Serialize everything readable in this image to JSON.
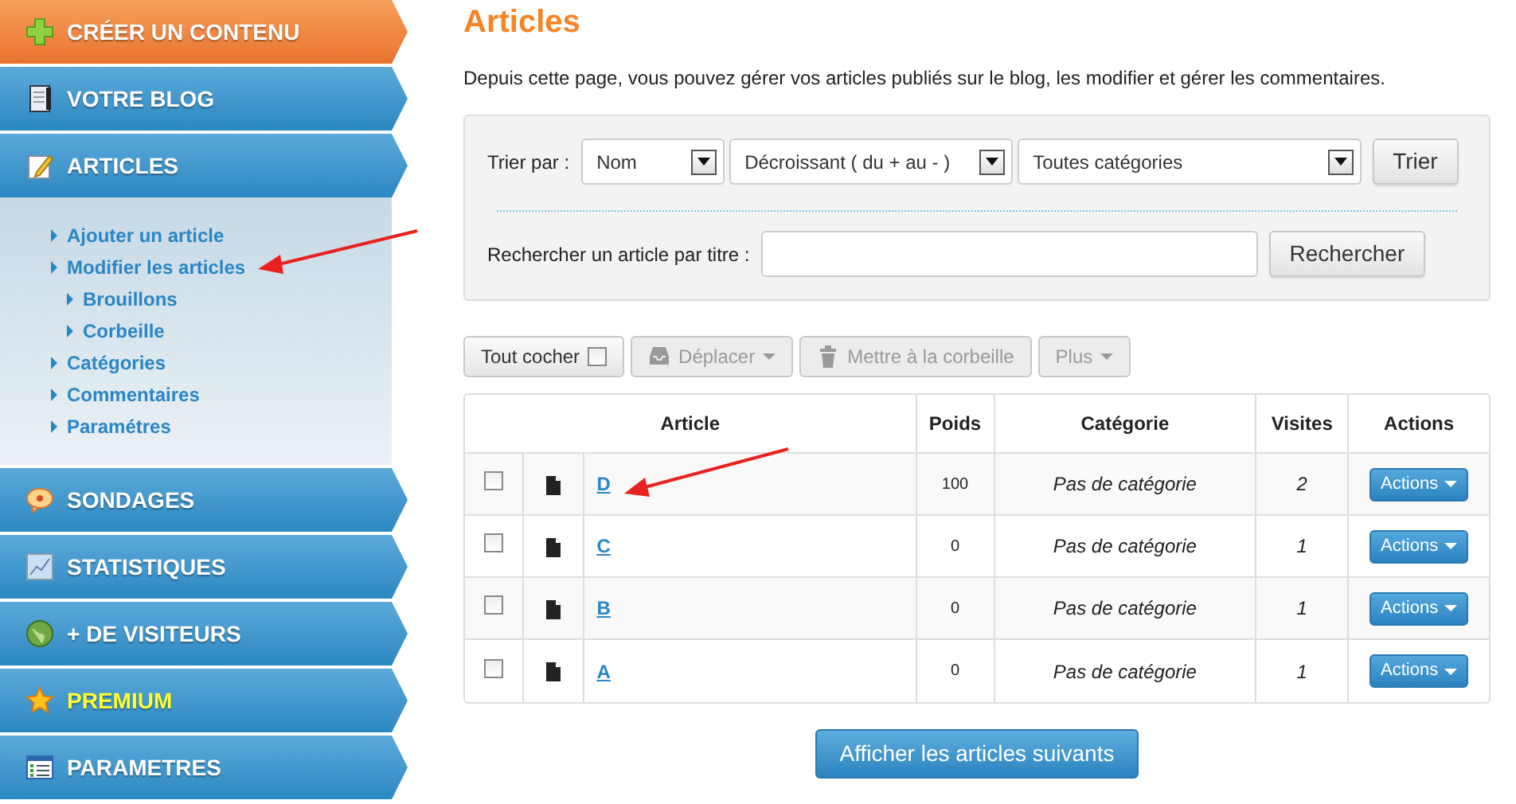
{
  "sidebar": {
    "items": [
      {
        "label": "CRÉER UN CONTENU",
        "kind": "create"
      },
      {
        "label": "VOTRE BLOG",
        "kind": "blog"
      },
      {
        "label": "ARTICLES",
        "kind": "articles",
        "expanded": true,
        "children": [
          {
            "label": "Ajouter un article"
          },
          {
            "label": "Modifier les articles",
            "children": [
              {
                "label": "Brouillons"
              },
              {
                "label": "Corbeille"
              }
            ]
          },
          {
            "label": "Catégories"
          },
          {
            "label": "Commentaires"
          },
          {
            "label": "Paramétres"
          }
        ]
      },
      {
        "label": "SONDAGES",
        "kind": "polls"
      },
      {
        "label": "STATISTIQUES",
        "kind": "stats"
      },
      {
        "label": "+ DE VISITEURS",
        "kind": "visitors"
      },
      {
        "label": "PREMIUM",
        "kind": "premium"
      },
      {
        "label": "PARAMETRES",
        "kind": "settings"
      }
    ]
  },
  "page": {
    "title": "Articles",
    "description": "Depuis cette page, vous pouvez gérer vos articles publiés sur le blog, les modifier et gérer les commentaires."
  },
  "filters": {
    "sort_label": "Trier par :",
    "selects": [
      {
        "value": "Nom"
      },
      {
        "value": "Décroissant ( du + au - )"
      },
      {
        "value": "Toutes catégories"
      }
    ],
    "sort_button": "Trier",
    "search_label": "Rechercher un article par titre :",
    "search_button": "Rechercher"
  },
  "toolbar": [
    {
      "label": "Tout cocher",
      "kind": "checkall",
      "disabled": false,
      "checked": false
    },
    {
      "label": "Déplacer",
      "kind": "move",
      "disabled": true
    },
    {
      "label": "Mettre à la corbeille",
      "kind": "trash",
      "disabled": true
    },
    {
      "label": "Plus",
      "kind": "more",
      "disabled": true
    }
  ],
  "table": {
    "columns": [
      "Article",
      "Poids",
      "Catégorie",
      "Visites",
      "Actions"
    ],
    "rows": [
      {
        "checked": false,
        "title": "D",
        "weight": "100",
        "category": "Pas de catégorie",
        "visits": "2",
        "action": "Actions"
      },
      {
        "checked": false,
        "title": "C",
        "weight": "0",
        "category": "Pas de catégorie",
        "visits": "1",
        "action": "Actions"
      },
      {
        "checked": false,
        "title": "B",
        "weight": "0",
        "category": "Pas de catégorie",
        "visits": "1",
        "action": "Actions"
      },
      {
        "checked": false,
        "title": "A",
        "weight": "0",
        "category": "Pas de catégorie",
        "visits": "1",
        "action": "Actions"
      }
    ]
  },
  "more_button": "Afficher les articles suivants"
}
